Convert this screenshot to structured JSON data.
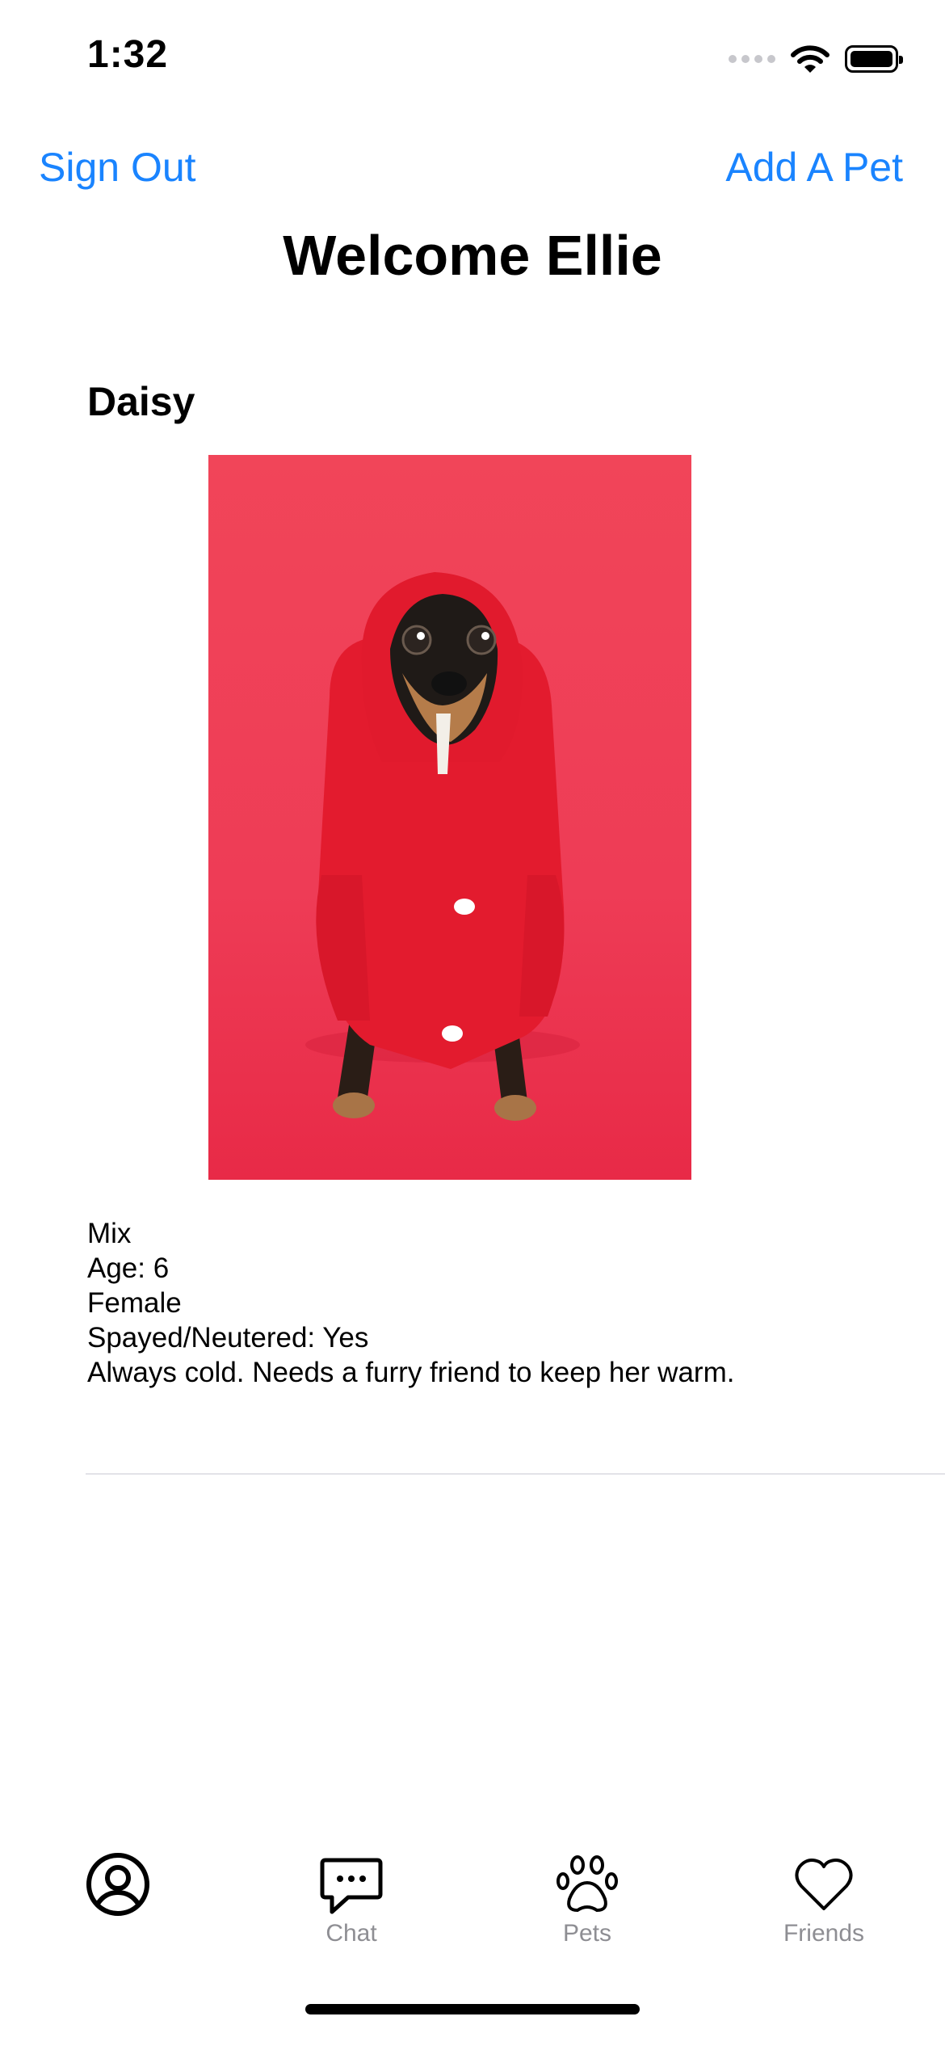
{
  "status_bar": {
    "time": "1:32"
  },
  "nav": {
    "sign_out": "Sign Out",
    "add_pet": "Add A Pet"
  },
  "title": "Welcome Ellie",
  "pet": {
    "name": "Daisy",
    "breed": "Mix",
    "age": "Age: 6",
    "sex": "Female",
    "spayed": "Spayed/Neutered: Yes",
    "bio": "Always cold. Needs a furry friend to keep her warm."
  },
  "tabs": [
    {
      "label": "",
      "icon": "profile-icon"
    },
    {
      "label": "Chat",
      "icon": "chat-icon"
    },
    {
      "label": "Pets",
      "icon": "paw-icon"
    },
    {
      "label": "Friends",
      "icon": "heart-icon"
    }
  ],
  "colors": {
    "accent": "#1a84ff",
    "tab_label": "#8e8e93",
    "photo_background": "#ef3a52",
    "hoodie": "#e5192c"
  }
}
